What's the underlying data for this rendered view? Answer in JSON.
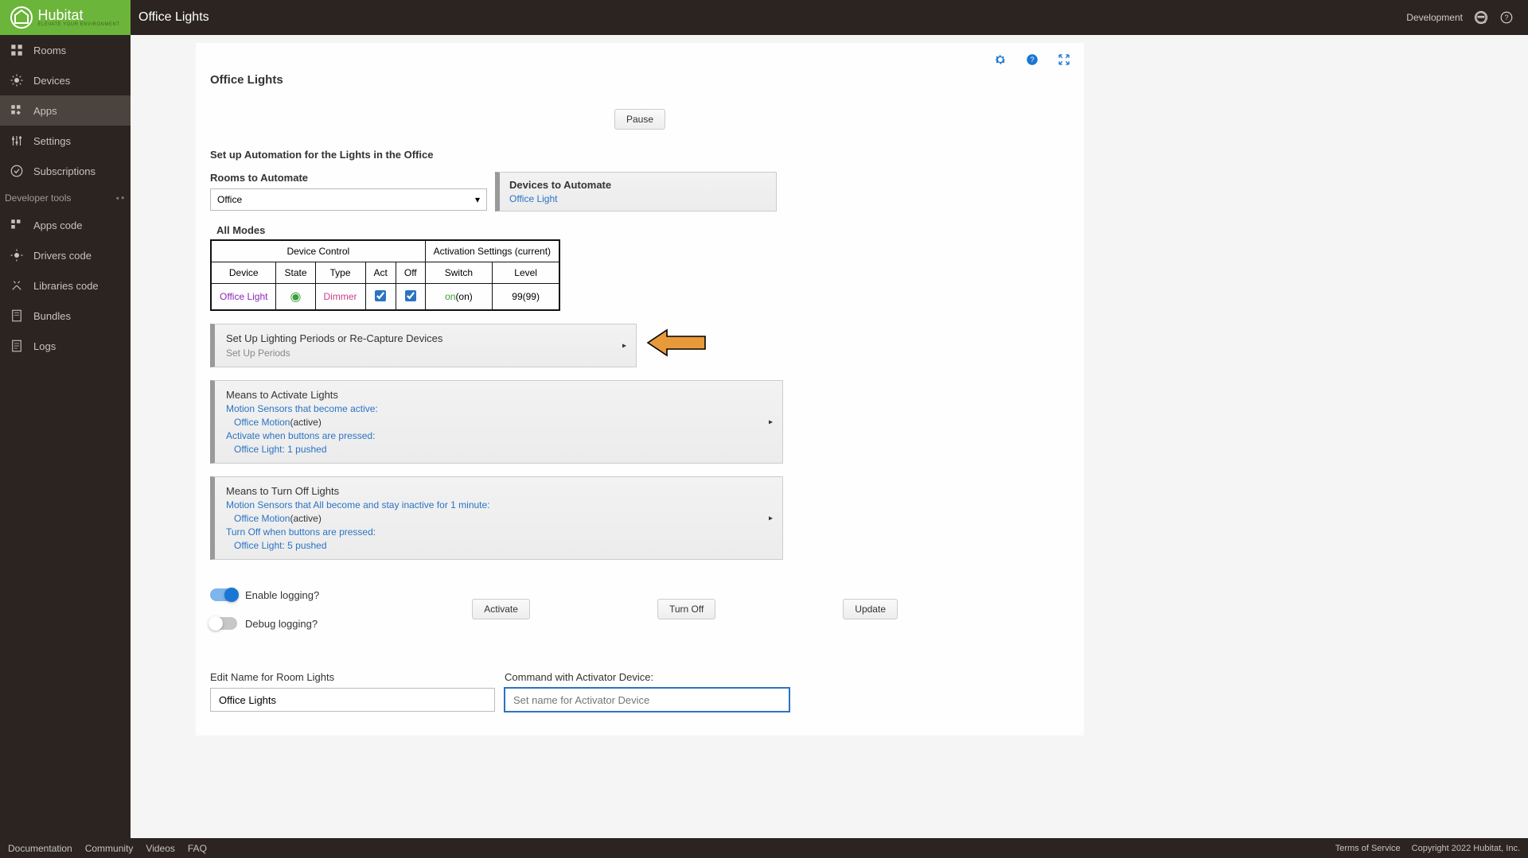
{
  "topbar": {
    "brand": "Hubitat",
    "tagline": "ELEVATE YOUR ENVIRONMENT",
    "page_title": "Office Lights",
    "env_label": "Development"
  },
  "sidebar": {
    "items": [
      {
        "label": "Rooms"
      },
      {
        "label": "Devices"
      },
      {
        "label": "Apps"
      },
      {
        "label": "Settings"
      },
      {
        "label": "Subscriptions"
      }
    ],
    "dev_section": "Developer tools",
    "dev_items": [
      {
        "label": "Apps code"
      },
      {
        "label": "Drivers code"
      },
      {
        "label": "Libraries code"
      },
      {
        "label": "Bundles"
      },
      {
        "label": "Logs"
      }
    ]
  },
  "page": {
    "heading": "Office Lights",
    "pause_btn": "Pause",
    "setup_title": "Set up Automation for the Lights in the Office",
    "rooms_label": "Rooms to Automate",
    "rooms_value": "Office",
    "devices_label": "Devices to Automate",
    "devices_link": "Office Light",
    "all_modes": "All Modes",
    "table": {
      "grp1": "Device Control",
      "grp2": "Activation Settings (current)",
      "cols": [
        "Device",
        "State",
        "Type",
        "Act",
        "Off",
        "Switch",
        "Level"
      ],
      "row": {
        "device": "Office Light",
        "type": "Dimmer",
        "switch_on": "on",
        "switch_cur": "(on)",
        "level_set": "99",
        "level_cur": "(99)"
      }
    },
    "periods_panel": {
      "title": "Set Up Lighting Periods or Re-Capture Devices",
      "sub": "Set Up Periods"
    },
    "activate_panel": {
      "title": "Means to Activate Lights",
      "l1": "Motion Sensors that become active:",
      "l1_link": "Office Motion",
      "l1_tail": "(active)",
      "l2": "Activate when buttons are pressed:",
      "l2_link": "Office Light: 1 pushed"
    },
    "turnoff_panel": {
      "title": "Means to Turn Off Lights",
      "l1": "Motion Sensors that All become and stay inactive for 1 minute:",
      "l1_link": "Office Motion",
      "l1_tail": "(active)",
      "l2": "Turn Off when buttons are pressed:",
      "l2_link": "Office Light: 5 pushed"
    },
    "enable_logging": "Enable logging?",
    "debug_logging": "Debug logging?",
    "activate_btn": "Activate",
    "turnoff_btn": "Turn Off",
    "update_btn": "Update",
    "edit_name_label": "Edit Name for Room Lights",
    "edit_name_value": "Office Lights",
    "command_label": "Command with Activator Device:",
    "command_placeholder": "Set name for Activator Device"
  },
  "footer": {
    "links": [
      "Documentation",
      "Community",
      "Videos",
      "FAQ"
    ],
    "tos": "Terms of Service",
    "copyright": "Copyright 2022 Hubitat, Inc."
  }
}
